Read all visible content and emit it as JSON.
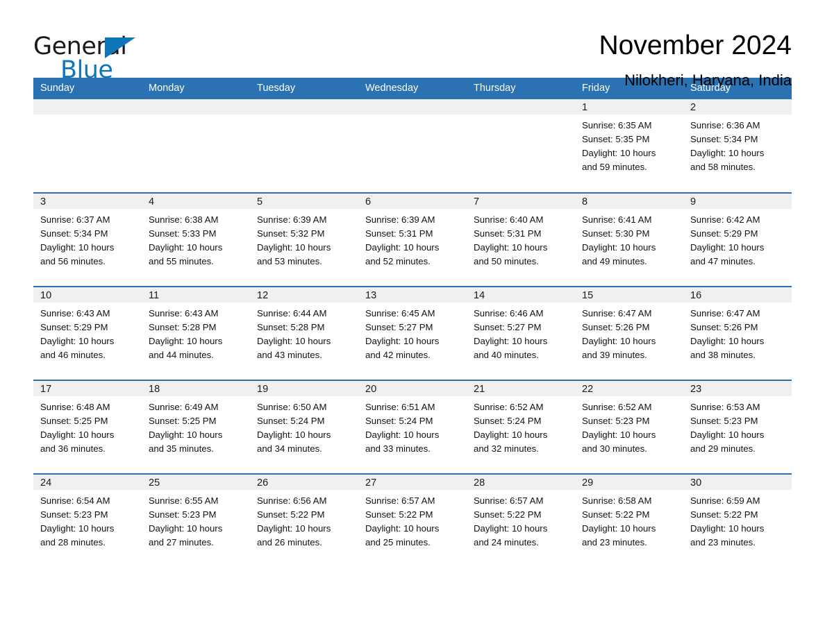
{
  "logo": {
    "word_one": "General",
    "word_two": "Blue",
    "triangle_icon": "triangle-icon",
    "brand_blue": "#1076bc"
  },
  "header": {
    "title": "November 2024",
    "subtitle": "Nilokheri, Haryana, India"
  },
  "theme": {
    "header_blue": "#2b72b2",
    "daynum_band_gray": "#f0f0f0",
    "text_black": "#000000"
  },
  "weekday_headers": [
    "Sunday",
    "Monday",
    "Tuesday",
    "Wednesday",
    "Thursday",
    "Friday",
    "Saturday"
  ],
  "calendar_data": {
    "month": "November",
    "year": 2024,
    "location": "Nilokheri, Haryana, India",
    "first_day_column": 5,
    "labels": {
      "sunrise_prefix": "Sunrise:",
      "sunset_prefix": "Sunset:",
      "daylight_prefix": "Daylight:"
    },
    "weeks": [
      [
        {
          "day": "",
          "lines": []
        },
        {
          "day": "",
          "lines": []
        },
        {
          "day": "",
          "lines": []
        },
        {
          "day": "",
          "lines": []
        },
        {
          "day": "",
          "lines": []
        },
        {
          "day": "1",
          "lines": [
            "Sunrise: 6:35 AM",
            "Sunset: 5:35 PM",
            "Daylight: 10 hours",
            "and 59 minutes."
          ]
        },
        {
          "day": "2",
          "lines": [
            "Sunrise: 6:36 AM",
            "Sunset: 5:34 PM",
            "Daylight: 10 hours",
            "and 58 minutes."
          ]
        }
      ],
      [
        {
          "day": "3",
          "lines": [
            "Sunrise: 6:37 AM",
            "Sunset: 5:34 PM",
            "Daylight: 10 hours",
            "and 56 minutes."
          ]
        },
        {
          "day": "4",
          "lines": [
            "Sunrise: 6:38 AM",
            "Sunset: 5:33 PM",
            "Daylight: 10 hours",
            "and 55 minutes."
          ]
        },
        {
          "day": "5",
          "lines": [
            "Sunrise: 6:39 AM",
            "Sunset: 5:32 PM",
            "Daylight: 10 hours",
            "and 53 minutes."
          ]
        },
        {
          "day": "6",
          "lines": [
            "Sunrise: 6:39 AM",
            "Sunset: 5:31 PM",
            "Daylight: 10 hours",
            "and 52 minutes."
          ]
        },
        {
          "day": "7",
          "lines": [
            "Sunrise: 6:40 AM",
            "Sunset: 5:31 PM",
            "Daylight: 10 hours",
            "and 50 minutes."
          ]
        },
        {
          "day": "8",
          "lines": [
            "Sunrise: 6:41 AM",
            "Sunset: 5:30 PM",
            "Daylight: 10 hours",
            "and 49 minutes."
          ]
        },
        {
          "day": "9",
          "lines": [
            "Sunrise: 6:42 AM",
            "Sunset: 5:29 PM",
            "Daylight: 10 hours",
            "and 47 minutes."
          ]
        }
      ],
      [
        {
          "day": "10",
          "lines": [
            "Sunrise: 6:43 AM",
            "Sunset: 5:29 PM",
            "Daylight: 10 hours",
            "and 46 minutes."
          ]
        },
        {
          "day": "11",
          "lines": [
            "Sunrise: 6:43 AM",
            "Sunset: 5:28 PM",
            "Daylight: 10 hours",
            "and 44 minutes."
          ]
        },
        {
          "day": "12",
          "lines": [
            "Sunrise: 6:44 AM",
            "Sunset: 5:28 PM",
            "Daylight: 10 hours",
            "and 43 minutes."
          ]
        },
        {
          "day": "13",
          "lines": [
            "Sunrise: 6:45 AM",
            "Sunset: 5:27 PM",
            "Daylight: 10 hours",
            "and 42 minutes."
          ]
        },
        {
          "day": "14",
          "lines": [
            "Sunrise: 6:46 AM",
            "Sunset: 5:27 PM",
            "Daylight: 10 hours",
            "and 40 minutes."
          ]
        },
        {
          "day": "15",
          "lines": [
            "Sunrise: 6:47 AM",
            "Sunset: 5:26 PM",
            "Daylight: 10 hours",
            "and 39 minutes."
          ]
        },
        {
          "day": "16",
          "lines": [
            "Sunrise: 6:47 AM",
            "Sunset: 5:26 PM",
            "Daylight: 10 hours",
            "and 38 minutes."
          ]
        }
      ],
      [
        {
          "day": "17",
          "lines": [
            "Sunrise: 6:48 AM",
            "Sunset: 5:25 PM",
            "Daylight: 10 hours",
            "and 36 minutes."
          ]
        },
        {
          "day": "18",
          "lines": [
            "Sunrise: 6:49 AM",
            "Sunset: 5:25 PM",
            "Daylight: 10 hours",
            "and 35 minutes."
          ]
        },
        {
          "day": "19",
          "lines": [
            "Sunrise: 6:50 AM",
            "Sunset: 5:24 PM",
            "Daylight: 10 hours",
            "and 34 minutes."
          ]
        },
        {
          "day": "20",
          "lines": [
            "Sunrise: 6:51 AM",
            "Sunset: 5:24 PM",
            "Daylight: 10 hours",
            "and 33 minutes."
          ]
        },
        {
          "day": "21",
          "lines": [
            "Sunrise: 6:52 AM",
            "Sunset: 5:24 PM",
            "Daylight: 10 hours",
            "and 32 minutes."
          ]
        },
        {
          "day": "22",
          "lines": [
            "Sunrise: 6:52 AM",
            "Sunset: 5:23 PM",
            "Daylight: 10 hours",
            "and 30 minutes."
          ]
        },
        {
          "day": "23",
          "lines": [
            "Sunrise: 6:53 AM",
            "Sunset: 5:23 PM",
            "Daylight: 10 hours",
            "and 29 minutes."
          ]
        }
      ],
      [
        {
          "day": "24",
          "lines": [
            "Sunrise: 6:54 AM",
            "Sunset: 5:23 PM",
            "Daylight: 10 hours",
            "and 28 minutes."
          ]
        },
        {
          "day": "25",
          "lines": [
            "Sunrise: 6:55 AM",
            "Sunset: 5:23 PM",
            "Daylight: 10 hours",
            "and 27 minutes."
          ]
        },
        {
          "day": "26",
          "lines": [
            "Sunrise: 6:56 AM",
            "Sunset: 5:22 PM",
            "Daylight: 10 hours",
            "and 26 minutes."
          ]
        },
        {
          "day": "27",
          "lines": [
            "Sunrise: 6:57 AM",
            "Sunset: 5:22 PM",
            "Daylight: 10 hours",
            "and 25 minutes."
          ]
        },
        {
          "day": "28",
          "lines": [
            "Sunrise: 6:57 AM",
            "Sunset: 5:22 PM",
            "Daylight: 10 hours",
            "and 24 minutes."
          ]
        },
        {
          "day": "29",
          "lines": [
            "Sunrise: 6:58 AM",
            "Sunset: 5:22 PM",
            "Daylight: 10 hours",
            "and 23 minutes."
          ]
        },
        {
          "day": "30",
          "lines": [
            "Sunrise: 6:59 AM",
            "Sunset: 5:22 PM",
            "Daylight: 10 hours",
            "and 23 minutes."
          ]
        }
      ]
    ]
  }
}
